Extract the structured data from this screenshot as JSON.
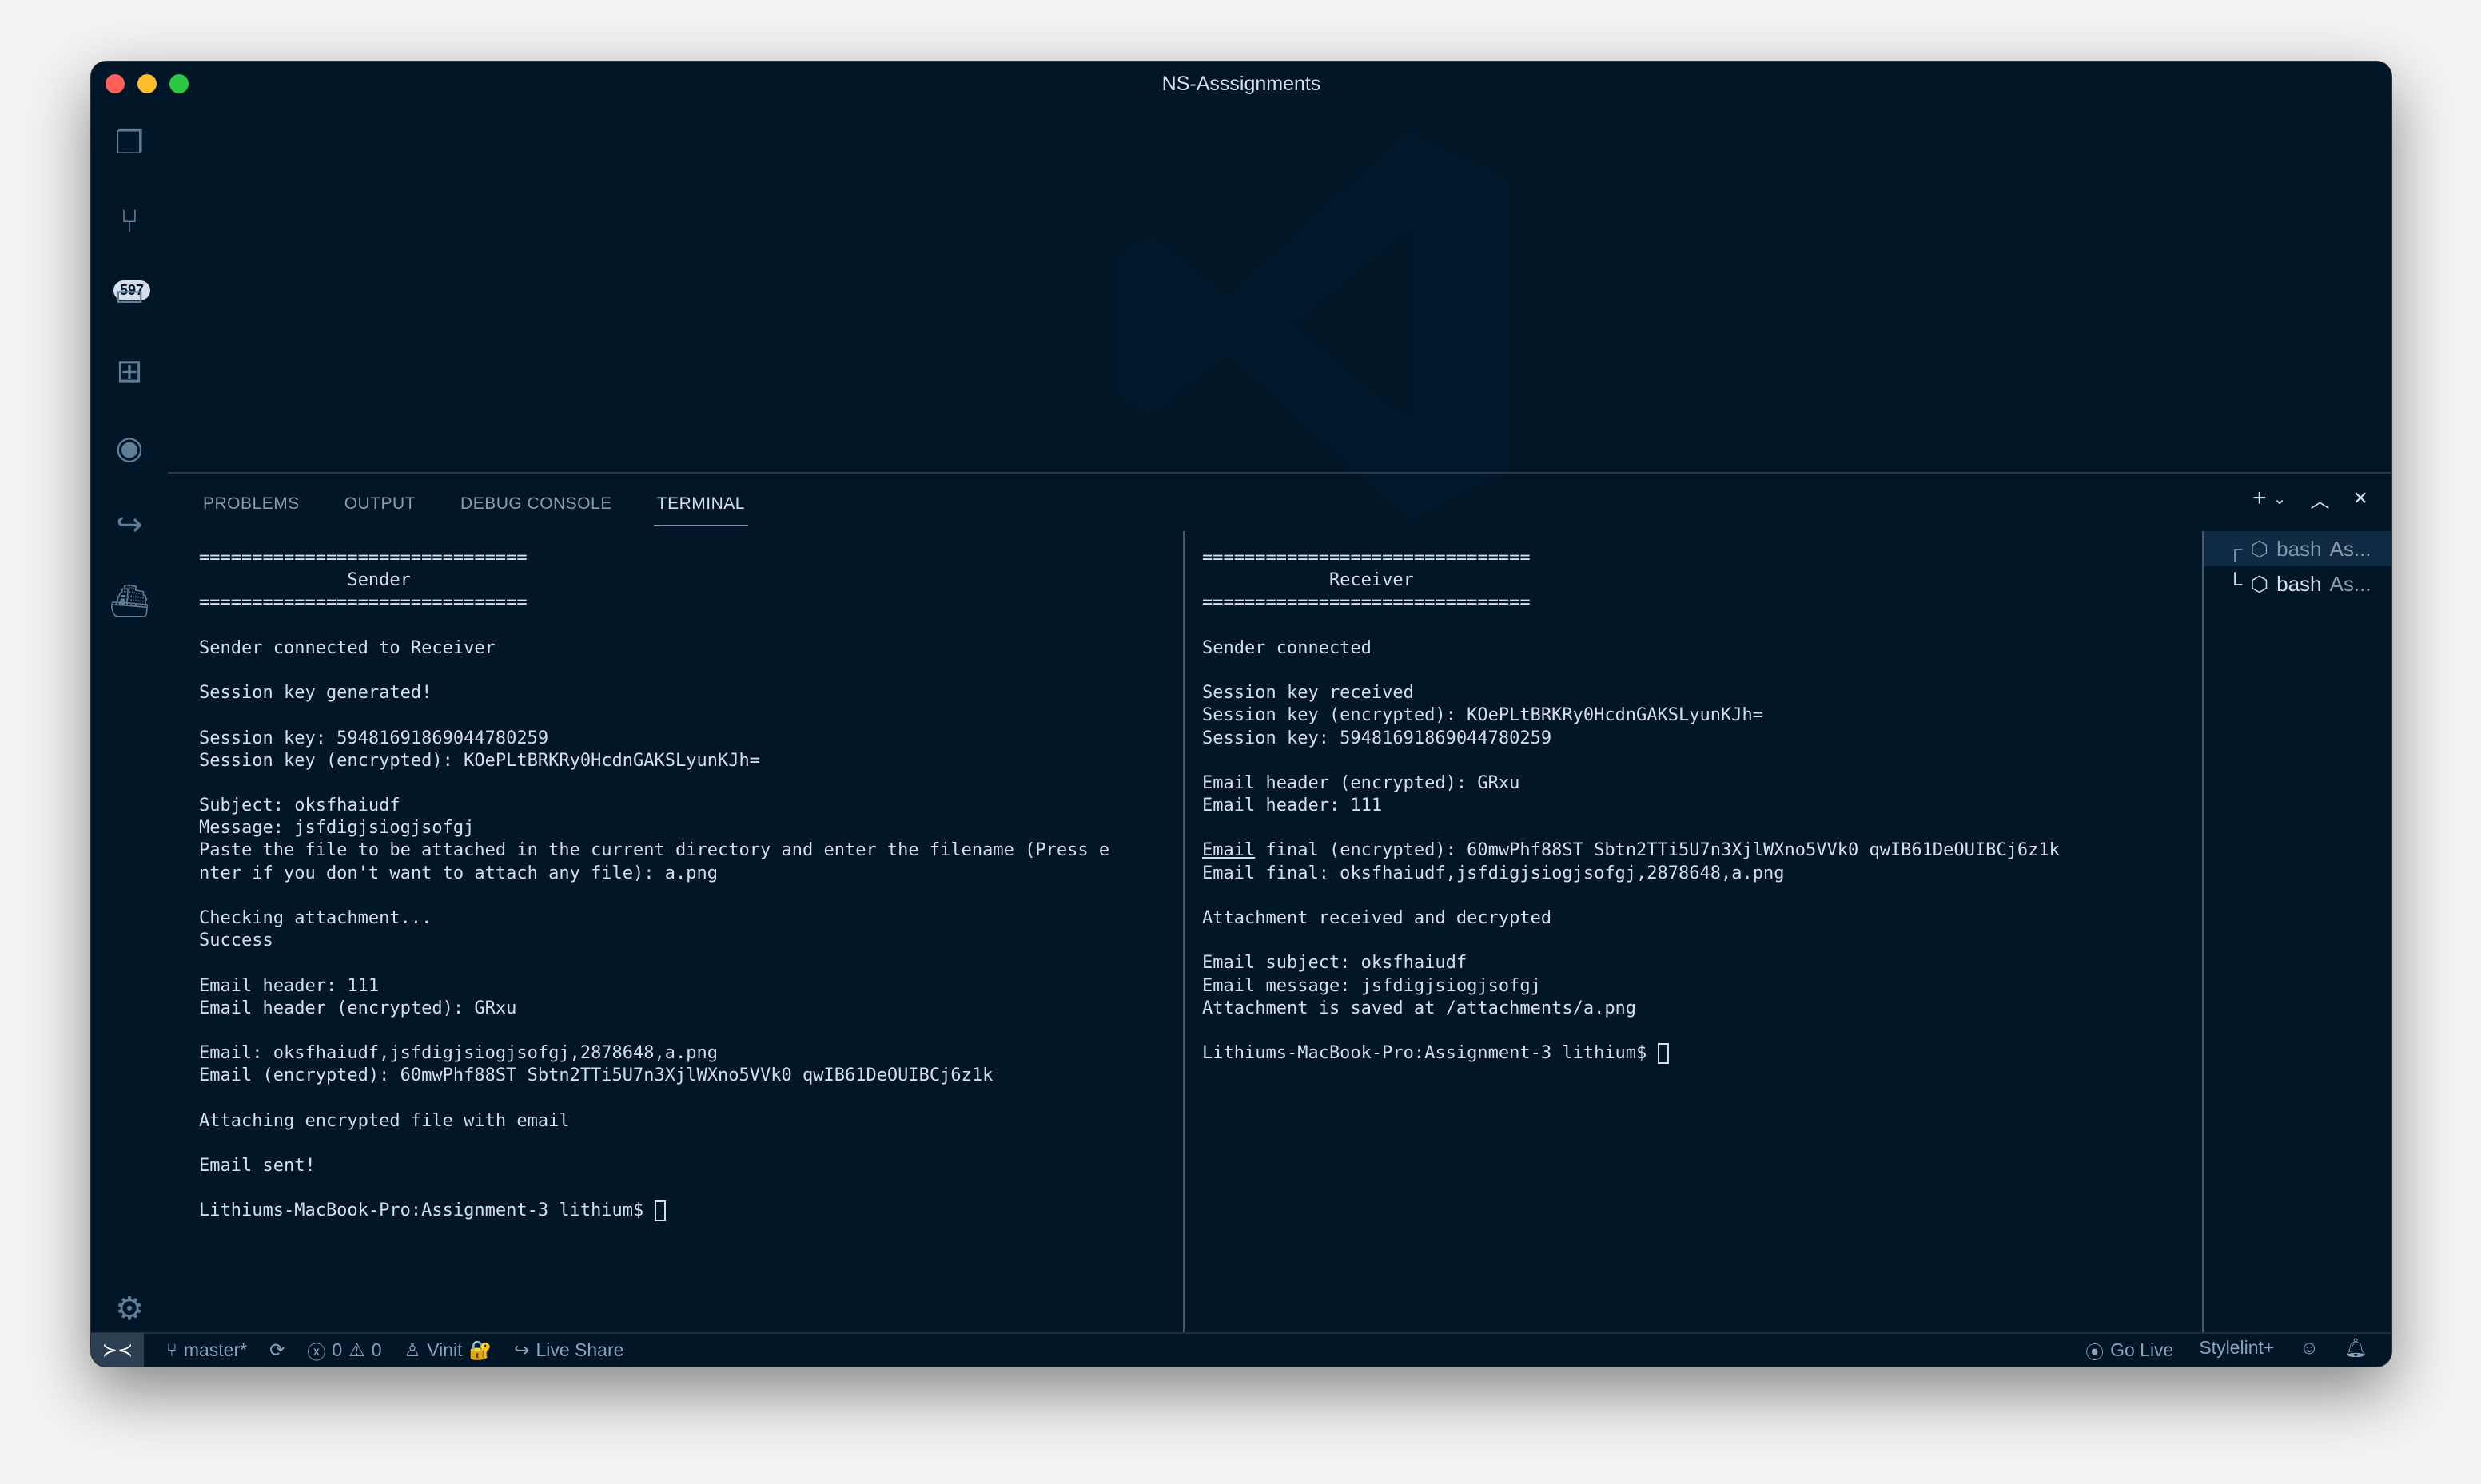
{
  "window": {
    "title": "NS-Asssignments"
  },
  "activity": {
    "scm_badge": "597"
  },
  "panel": {
    "tabs": [
      "PROBLEMS",
      "OUTPUT",
      "DEBUG CONSOLE",
      "TERMINAL"
    ]
  },
  "terminal": {
    "left": [
      "===============================",
      "              Sender",
      "===============================",
      "",
      "Sender connected to Receiver",
      "",
      "Session key generated!",
      "",
      "Session key: 59481691869044780259",
      "Session key (encrypted): KOePLtBRKRy0HcdnGAKSLyunKJh=",
      "",
      "Subject: oksfhaiudf",
      "Message: jsfdigjsiogjsofgj",
      "Paste the file to be attached in the current directory and enter the filename (Press e",
      "nter if you don't want to attach any file): a.png",
      "",
      "Checking attachment...",
      "Success",
      "",
      "Email header: 111",
      "Email header (encrypted): GRxu",
      "",
      "Email: oksfhaiudf,jsfdigjsiogjsofgj,2878648,a.png",
      "Email (encrypted): 60mwPhf88ST Sbtn2TTi5U7n3XjlWXno5VVk0 qwIB61DeOUIBCj6z1k",
      "",
      "Attaching encrypted file with email",
      "",
      "Email sent!",
      ""
    ],
    "left_prompt": "Lithiums-MacBook-Pro:Assignment-3 lithium$ ",
    "right": [
      "===============================",
      "            Receiver",
      "===============================",
      "",
      "Sender connected",
      "",
      "Session key received",
      "Session key (encrypted): KOePLtBRKRy0HcdnGAKSLyunKJh=",
      "Session key: 59481691869044780259",
      "",
      "Email header (encrypted): GRxu",
      "Email header: 111",
      ""
    ],
    "right_email_word": "Email",
    "right_email_final_enc": " final (encrypted): 60mwPhf88ST Sbtn2TTi5U7n3XjlWXno5VVk0 qwIB61DeOUIBCj6z1k",
    "right2": [
      "Email final: oksfhaiudf,jsfdigjsiogjsofgj,2878648,a.png",
      "",
      "Attachment received and decrypted",
      "",
      "Email subject: oksfhaiudf",
      "Email message: jsfdigjsiogjsofgj",
      "Attachment is saved at /attachments/a.png",
      ""
    ],
    "right_prompt": "Lithiums-MacBook-Pro:Assignment-3 lithium$ ",
    "instances": [
      {
        "name": "bash",
        "cwd": "As..."
      },
      {
        "name": "bash",
        "cwd": "As..."
      }
    ]
  },
  "status": {
    "branch": "master*",
    "errors": "0",
    "warnings": "0",
    "user": "Vinit",
    "live_share": "Live Share",
    "go_live": "Go Live",
    "stylelint": "Stylelint+"
  }
}
